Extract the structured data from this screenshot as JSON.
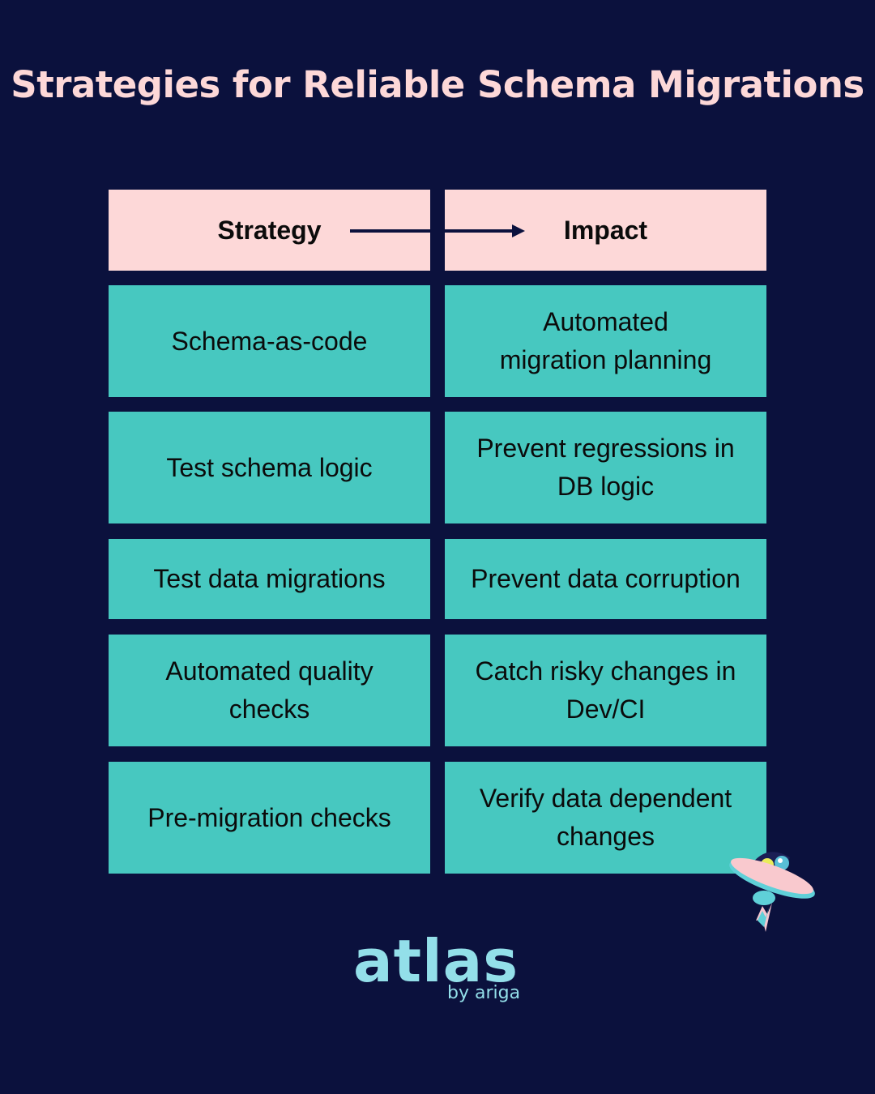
{
  "title": "Strategies for Reliable Schema Migrations",
  "header": {
    "left": "Strategy",
    "right": "Impact",
    "connector_icon": "arrow-right-icon"
  },
  "rows": [
    {
      "strategy": "Schema-as-code",
      "impact": "Automated migration planning"
    },
    {
      "strategy": "Test schema logic",
      "impact": "Prevent regressions in DB logic"
    },
    {
      "strategy": "Test data migrations",
      "impact": "Prevent data corruption"
    },
    {
      "strategy": "Automated quality checks",
      "impact": "Catch risky changes in Dev/CI"
    },
    {
      "strategy": "Pre-migration checks",
      "impact": "Verify data dependent changes"
    }
  ],
  "brand": {
    "name": "atlas",
    "byline": "by ariga",
    "mascot_icon": "ufo-mascot-icon"
  },
  "colors": {
    "background": "#0b113d",
    "header_fill": "#fdd8d8",
    "row_fill": "#47c8c0",
    "title": "#fdd8d8",
    "logo": "#93dfe9"
  }
}
